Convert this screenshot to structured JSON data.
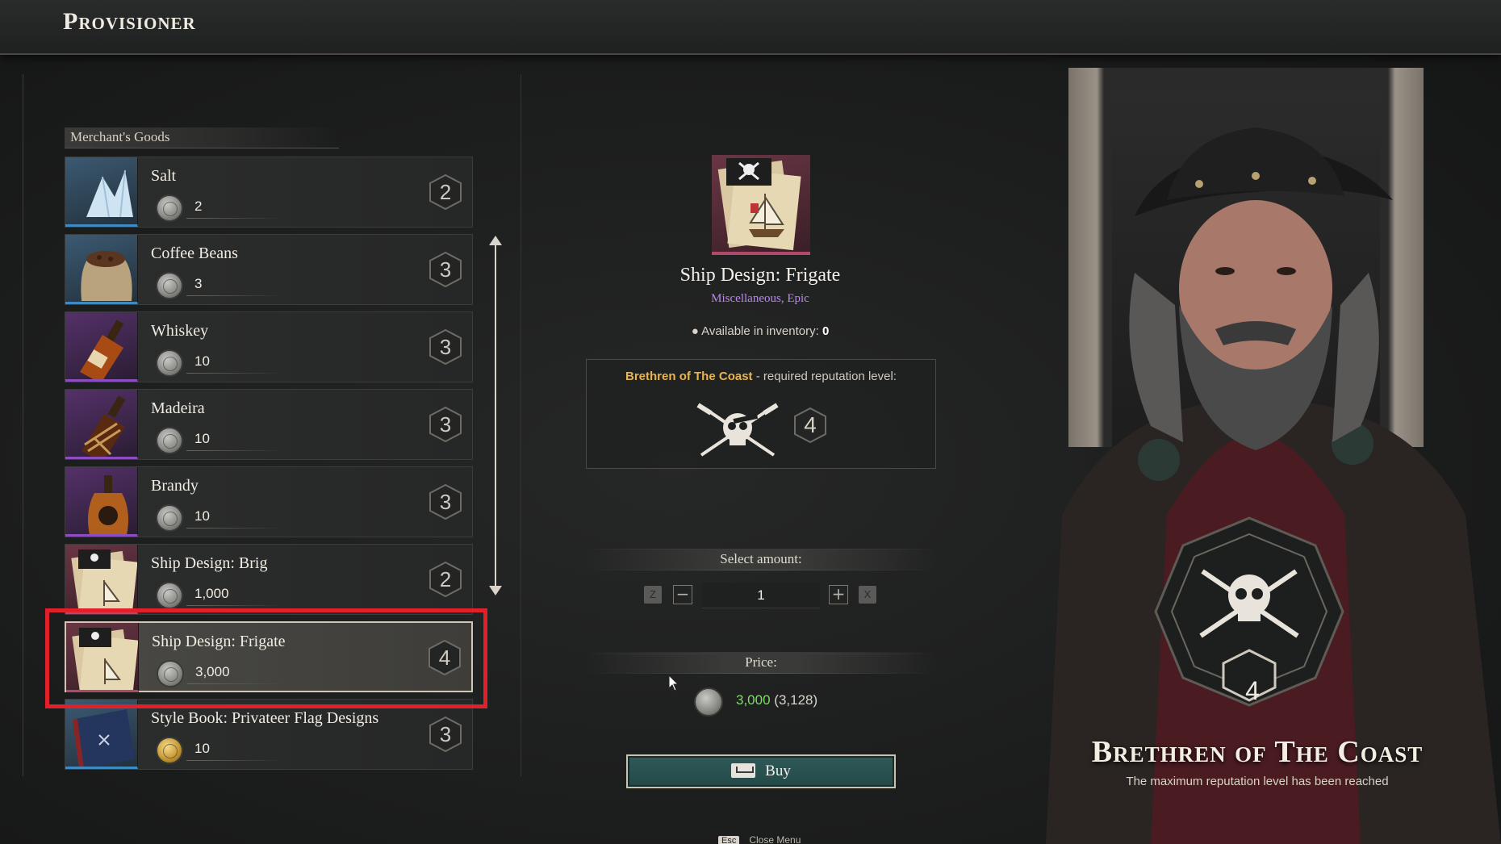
{
  "app": {
    "title": "Provisioner"
  },
  "goods_header": "Merchant's Goods",
  "goods": [
    {
      "name": "Salt",
      "price": "2",
      "rep": "2",
      "rarity": "common",
      "icon": "salt-crystal-icon",
      "currency": "silver"
    },
    {
      "name": "Coffee Beans",
      "price": "3",
      "rep": "3",
      "rarity": "common",
      "icon": "coffee-sack-icon",
      "currency": "silver"
    },
    {
      "name": "Whiskey",
      "price": "10",
      "rep": "3",
      "rarity": "rare",
      "icon": "whiskey-bottle-icon",
      "currency": "silver"
    },
    {
      "name": "Madeira",
      "price": "10",
      "rep": "3",
      "rarity": "rare",
      "icon": "madeira-bottle-icon",
      "currency": "silver"
    },
    {
      "name": "Brandy",
      "price": "10",
      "rep": "3",
      "rarity": "rare",
      "icon": "brandy-bottle-icon",
      "currency": "silver"
    },
    {
      "name": "Ship Design: Brig",
      "price": "1,000",
      "rep": "2",
      "rarity": "epic",
      "icon": "ship-blueprint-icon",
      "currency": "silver"
    },
    {
      "name": "Ship Design: Frigate",
      "price": "3,000",
      "rep": "4",
      "rarity": "epic",
      "icon": "ship-blueprint-icon",
      "currency": "silver",
      "selected": true
    },
    {
      "name": "Style Book: Privateer Flag Designs",
      "price": "10",
      "rep": "3",
      "rarity": "common",
      "icon": "flag-book-icon",
      "currency": "gold"
    }
  ],
  "detail": {
    "title": "Ship Design: Frigate",
    "category": "Miscellaneous, Epic",
    "inventory_label": "Available in inventory:",
    "inventory_count": "0",
    "faction": "Brethren of The Coast",
    "rep_text": " - required reputation level:",
    "required_level": "4",
    "select_amount_label": "Select amount:",
    "amount": "1",
    "key_decrease": "Z",
    "key_increase": "X",
    "price_label": "Price:",
    "price": "3,000",
    "price_total": "(3,128)",
    "buy_label": "Buy",
    "close_key": "Esc",
    "close_label": "Close Menu"
  },
  "faction_panel": {
    "name": "Brethren of The Coast",
    "level": "4",
    "status": "The maximum reputation level has been reached"
  },
  "colors": {
    "accent_rep_faction": "#e9b453",
    "epic_purple": "#b98ae8",
    "affordable_green": "#7fdc6a",
    "buy_button": "#2e5a58",
    "annotation_red": "#e0202a"
  }
}
